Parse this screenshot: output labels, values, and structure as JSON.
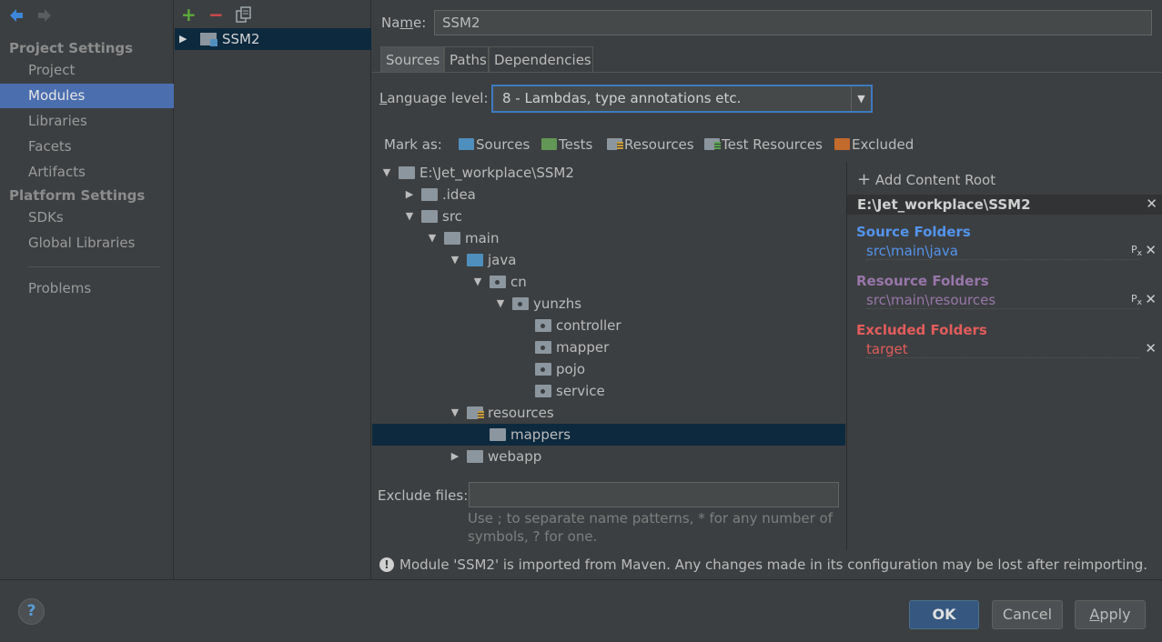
{
  "nav": {
    "project_settings": "Project Settings",
    "platform_settings": "Platform Settings",
    "items": [
      "Project",
      "Modules",
      "Libraries",
      "Facets",
      "Artifacts"
    ],
    "platform_items": [
      "SDKs",
      "Global Libraries"
    ],
    "problems": "Problems"
  },
  "modules": {
    "add_icon": "+",
    "remove_icon": "−",
    "list": [
      "SSM2"
    ]
  },
  "module": {
    "name_label": "Name:",
    "name_value": "SSM2",
    "tabs": [
      "Sources",
      "Paths",
      "Dependencies"
    ],
    "active_tab": "Sources",
    "language_label": "Language level:",
    "language_value": "8 - Lambdas, type annotations etc.",
    "mark_as_label": "Mark as:",
    "mark_as": [
      "Sources",
      "Tests",
      "Resources",
      "Test Resources",
      "Excluded"
    ],
    "mark_colors": {
      "Sources": "#4f8fbd",
      "Tests": "#629755",
      "Resources": "#8c969e",
      "Test Resources": "#8c969e",
      "Excluded": "#c36a2d"
    }
  },
  "tree": [
    {
      "label": "E:\\Jet_workplace\\SSM2",
      "depth": 0,
      "arrow": "▼",
      "type": "folder"
    },
    {
      "label": ".idea",
      "depth": 1,
      "arrow": "▶",
      "type": "folder"
    },
    {
      "label": "src",
      "depth": 1,
      "arrow": "▼",
      "type": "folder"
    },
    {
      "label": "main",
      "depth": 2,
      "arrow": "▼",
      "type": "folder"
    },
    {
      "label": "java",
      "depth": 3,
      "arrow": "▼",
      "type": "source"
    },
    {
      "label": "cn",
      "depth": 4,
      "arrow": "▼",
      "type": "package"
    },
    {
      "label": "yunzhs",
      "depth": 5,
      "arrow": "▼",
      "type": "package"
    },
    {
      "label": "controller",
      "depth": 6,
      "arrow": "",
      "type": "package"
    },
    {
      "label": "mapper",
      "depth": 6,
      "arrow": "",
      "type": "package"
    },
    {
      "label": "pojo",
      "depth": 6,
      "arrow": "",
      "type": "package"
    },
    {
      "label": "service",
      "depth": 6,
      "arrow": "",
      "type": "package"
    },
    {
      "label": "resources",
      "depth": 3,
      "arrow": "▼",
      "type": "resource"
    },
    {
      "label": "mappers",
      "depth": 4,
      "arrow": "",
      "type": "folder",
      "selected": true
    },
    {
      "label": "webapp",
      "depth": 3,
      "arrow": "▶",
      "type": "folder"
    }
  ],
  "exclude": {
    "label": "Exclude files:",
    "value": "",
    "hint_line1": "Use ; to separate name patterns, * for any number of",
    "hint_line2": "symbols, ? for one."
  },
  "content_root": {
    "add_label": "Add Content Root",
    "root_path": "E:\\Jet_workplace\\SSM2",
    "source_title": "Source Folders",
    "source_path": "src\\main\\java",
    "resource_title": "Resource Folders",
    "resource_path": "src\\main\\resources",
    "excluded_title": "Excluded Folders",
    "excluded_path": "target",
    "colors": {
      "source": "#5394ec",
      "resource": "#9876aa",
      "excluded": "#e25c5c"
    }
  },
  "warning": "Module 'SSM2' is imported from Maven. Any changes made in its configuration may be lost after reimporting.",
  "buttons": {
    "help": "?",
    "ok": "OK",
    "cancel": "Cancel",
    "apply": "Apply"
  }
}
